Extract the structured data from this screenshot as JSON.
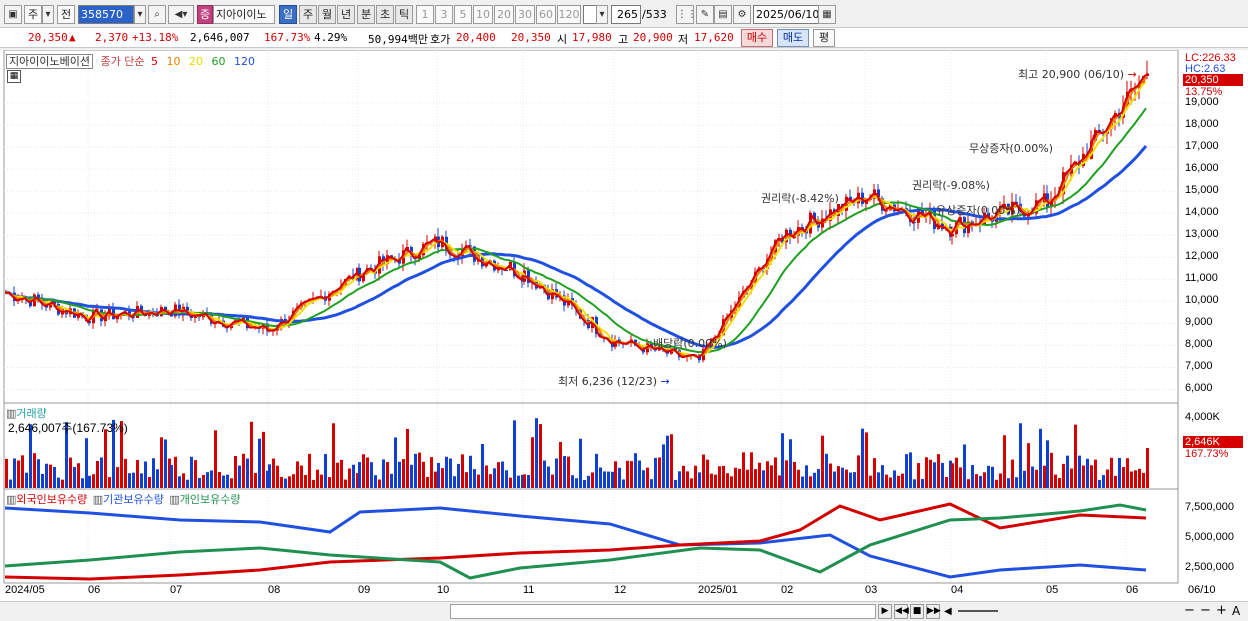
{
  "toolbar": {
    "market": "주",
    "prev_label": "전",
    "code": "358570",
    "type_badge": "증",
    "stock_name": "지아이이노",
    "periods": [
      "일",
      "주",
      "월",
      "년",
      "분",
      "초",
      "틱"
    ],
    "active_period": "일",
    "intervals": [
      "1",
      "3",
      "5",
      "10",
      "20",
      "30",
      "60",
      "120"
    ],
    "count_current": "265",
    "count_total": "/533",
    "date": "2025/06/10"
  },
  "quote": {
    "price": "20,350",
    "change": "2,370",
    "change_pct": "+13.18%",
    "volume": "2,646,007",
    "volume_ratio": "167.73%",
    "turnover": "4.29%",
    "amount": "50,994백만",
    "bid_label": "호가",
    "bid": "20,400",
    "ask": "20,350",
    "open_label": "시",
    "open": "17,980",
    "high_label": "고",
    "high": "20,900",
    "low_label": "저",
    "low": "17,620",
    "buy_label": "매수",
    "sell_label": "매도",
    "eval_label": "평"
  },
  "price_panel": {
    "title": "지아이이노베이션",
    "ma_label": "종가 단순",
    "ma_periods": [
      "5",
      "10",
      "20",
      "60",
      "120"
    ],
    "ma_colors": [
      "#d40000",
      "#f08000",
      "#f0e000",
      "#20a020",
      "#2050e0"
    ],
    "lc": "LC:226.33",
    "hc": "HC:2.63",
    "last_price": "20,350",
    "last_pct": "13.75%",
    "y_ticks": [
      "19,000",
      "18,000",
      "17,000",
      "16,000",
      "15,000",
      "14,000",
      "13,000",
      "12,000",
      "11,000",
      "10,000",
      "9,000",
      "8,000",
      "7,000",
      "6,000"
    ],
    "annotations": {
      "high": "최고 20,900 (06/10)",
      "low": "최저 6,236 (12/23)",
      "rights1": "권리락(-8.42%)",
      "rights2": "권리락(-9.08%)",
      "bonus": "무상증자(0.00%)",
      "paid": "유상증자(0.00%)",
      "dividend": "배당락(0.00%)"
    }
  },
  "volume_panel": {
    "title": "거래량",
    "value": "2,646,007주(167.73%)",
    "y_tick": "4,000K",
    "last": "2,646K",
    "last_pct": "167.73%"
  },
  "holding_panel": {
    "series": [
      "외국인보유수량",
      "기관보유수량",
      "개인보유수량"
    ],
    "series_colors": [
      "#d40000",
      "#2050e0",
      "#209050"
    ],
    "y_ticks": [
      "7,500,000",
      "5,000,000",
      "2,500,000"
    ]
  },
  "x_axis": {
    "labels": [
      "2024/05",
      "06",
      "07",
      "08",
      "09",
      "10",
      "11",
      "12",
      "2025/01",
      "02",
      "03",
      "04",
      "05",
      "06"
    ],
    "right_label": "06/10"
  },
  "chart_data": {
    "type": "line",
    "x": [
      "2024/05",
      "06",
      "07",
      "08",
      "09",
      "10",
      "11",
      "12",
      "2025/01",
      "02",
      "03",
      "04",
      "05",
      "06/10"
    ],
    "series": [
      {
        "name": "종가",
        "values": [
          10400,
          9300,
          9600,
          8700,
          11300,
          12700,
          11300,
          8200,
          7300,
          13000,
          14800,
          13400,
          14500,
          20350
        ]
      }
    ],
    "ylim": [
      5500,
      21000
    ]
  }
}
